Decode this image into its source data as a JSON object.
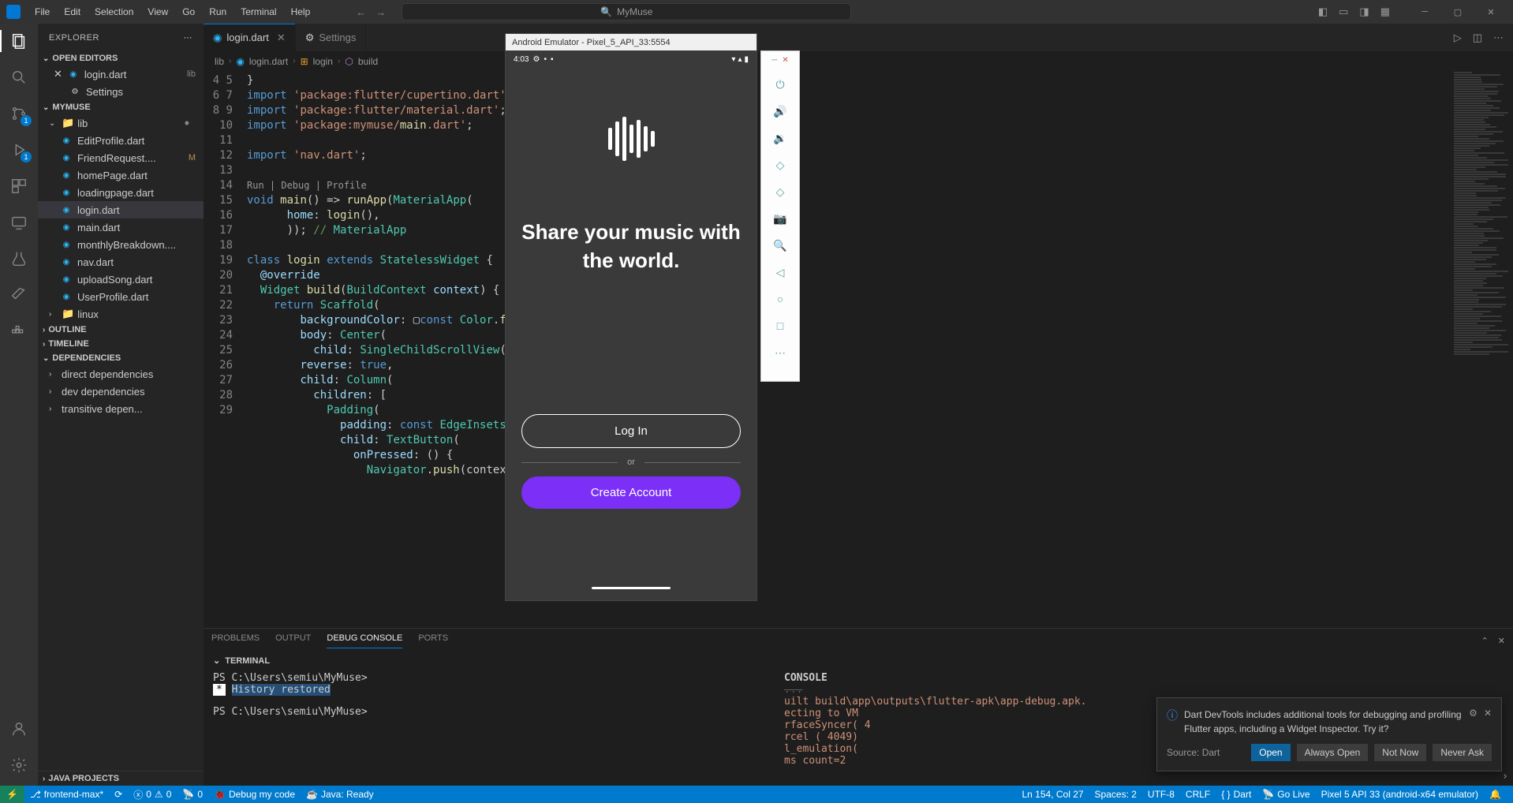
{
  "titlebar": {
    "menus": [
      "File",
      "Edit",
      "Selection",
      "View",
      "Go",
      "Run",
      "Terminal",
      "Help"
    ],
    "search_label": "MyMuse"
  },
  "sidebar": {
    "title": "EXPLORER",
    "open_editors_label": "OPEN EDITORS",
    "open_editors": [
      {
        "name": "login.dart",
        "ext": "lib"
      },
      {
        "name": "Settings",
        "ext": ""
      }
    ],
    "project_label": "MYMUSE",
    "lib_folder": "lib",
    "files": [
      "EditProfile.dart",
      "FriendRequest....",
      "homePage.dart",
      "loadingpage.dart",
      "login.dart",
      "main.dart",
      "monthlyBreakdown....",
      "nav.dart",
      "uploadSong.dart",
      "UserProfile.dart"
    ],
    "active_file_index": 4,
    "modified_file_index": 1,
    "linux_folder": "linux",
    "outline_label": "OUTLINE",
    "timeline_label": "TIMELINE",
    "dependencies_label": "DEPENDENCIES",
    "deps": [
      "direct dependencies",
      "dev dependencies",
      "transitive depen..."
    ],
    "java_projects_label": "JAVA PROJECTS"
  },
  "tabs": {
    "t1": "login.dart",
    "t2": "Settings"
  },
  "breadcrumb": {
    "p1": "lib",
    "p2": "login.dart",
    "p3": "login",
    "p4": "build"
  },
  "code": {
    "line_start": 4,
    "lines": [
      "}",
      "import 'package:flutter/cupertino.dart';",
      "import 'package:flutter/material.dart';",
      "import 'package:mymuse/main.dart';",
      "",
      "import 'nav.dart';",
      "",
      "Run | Debug | Profile",
      "void main() => runApp(MaterialApp(",
      "      home: login(),",
      "      )); // MaterialApp",
      "",
      "class login extends StatelessWidget {",
      "  @override",
      "  Widget build(BuildContext context) {",
      "    return Scaffold(",
      "        backgroundColor: ▢const Color.fromARGB",
      "        body: Center(",
      "          child: SingleChildScrollView(",
      "        reverse: true,",
      "        child: Column(",
      "          children: [",
      "            Padding(",
      "              padding: const EdgeInsets.fromL",
      "              child: TextButton(",
      "                onPressed: () {",
      "                  Navigator.push(context"
    ]
  },
  "panel": {
    "problems": "PROBLEMS",
    "output": "OUTPUT",
    "debug_console": "DEBUG CONSOLE",
    "ports": "PORTS",
    "terminal": "TERMINAL",
    "prompt1": "PS C:\\Users\\semiu\\MyMuse>",
    "hist_star": "*",
    "hist": "History restored",
    "prompt2": "PS C:\\Users\\semiu\\MyMuse>",
    "right_label": "CONSOLE",
    "right_lines": [
      "uilt build\\app\\outputs\\flutter-apk\\app-debug.apk.",
      "ecting to VM ",
      "rfaceSyncer( 4",
      "rcel  ( 4049)",
      "l_emulation(",
      "ms count=2"
    ]
  },
  "emulator": {
    "title": "Android Emulator - Pixel_5_API_33:5554",
    "time": "4:03",
    "tagline": "Share your music with the world.",
    "login_btn": "Log In",
    "or": "or",
    "create_btn": "Create Account"
  },
  "toast": {
    "message": "Dart DevTools includes additional tools for debugging and profiling Flutter apps, including a Widget Inspector. Try it?",
    "source": "Source: Dart",
    "btn_open": "Open",
    "btn_always": "Always Open",
    "btn_not_now": "Not Now",
    "btn_never": "Never Ask"
  },
  "statusbar": {
    "branch": "frontend-max*",
    "errors": "0",
    "warnings": "0",
    "ports": "0",
    "debug": "Debug my code",
    "java": "Java: Ready",
    "ln": "Ln 154, Col 27",
    "spaces": "Spaces: 2",
    "enc": "UTF-8",
    "eol": "CRLF",
    "lang": "Dart",
    "golive": "Go Live",
    "device": "Pixel 5 API 33 (android-x64 emulator)"
  }
}
